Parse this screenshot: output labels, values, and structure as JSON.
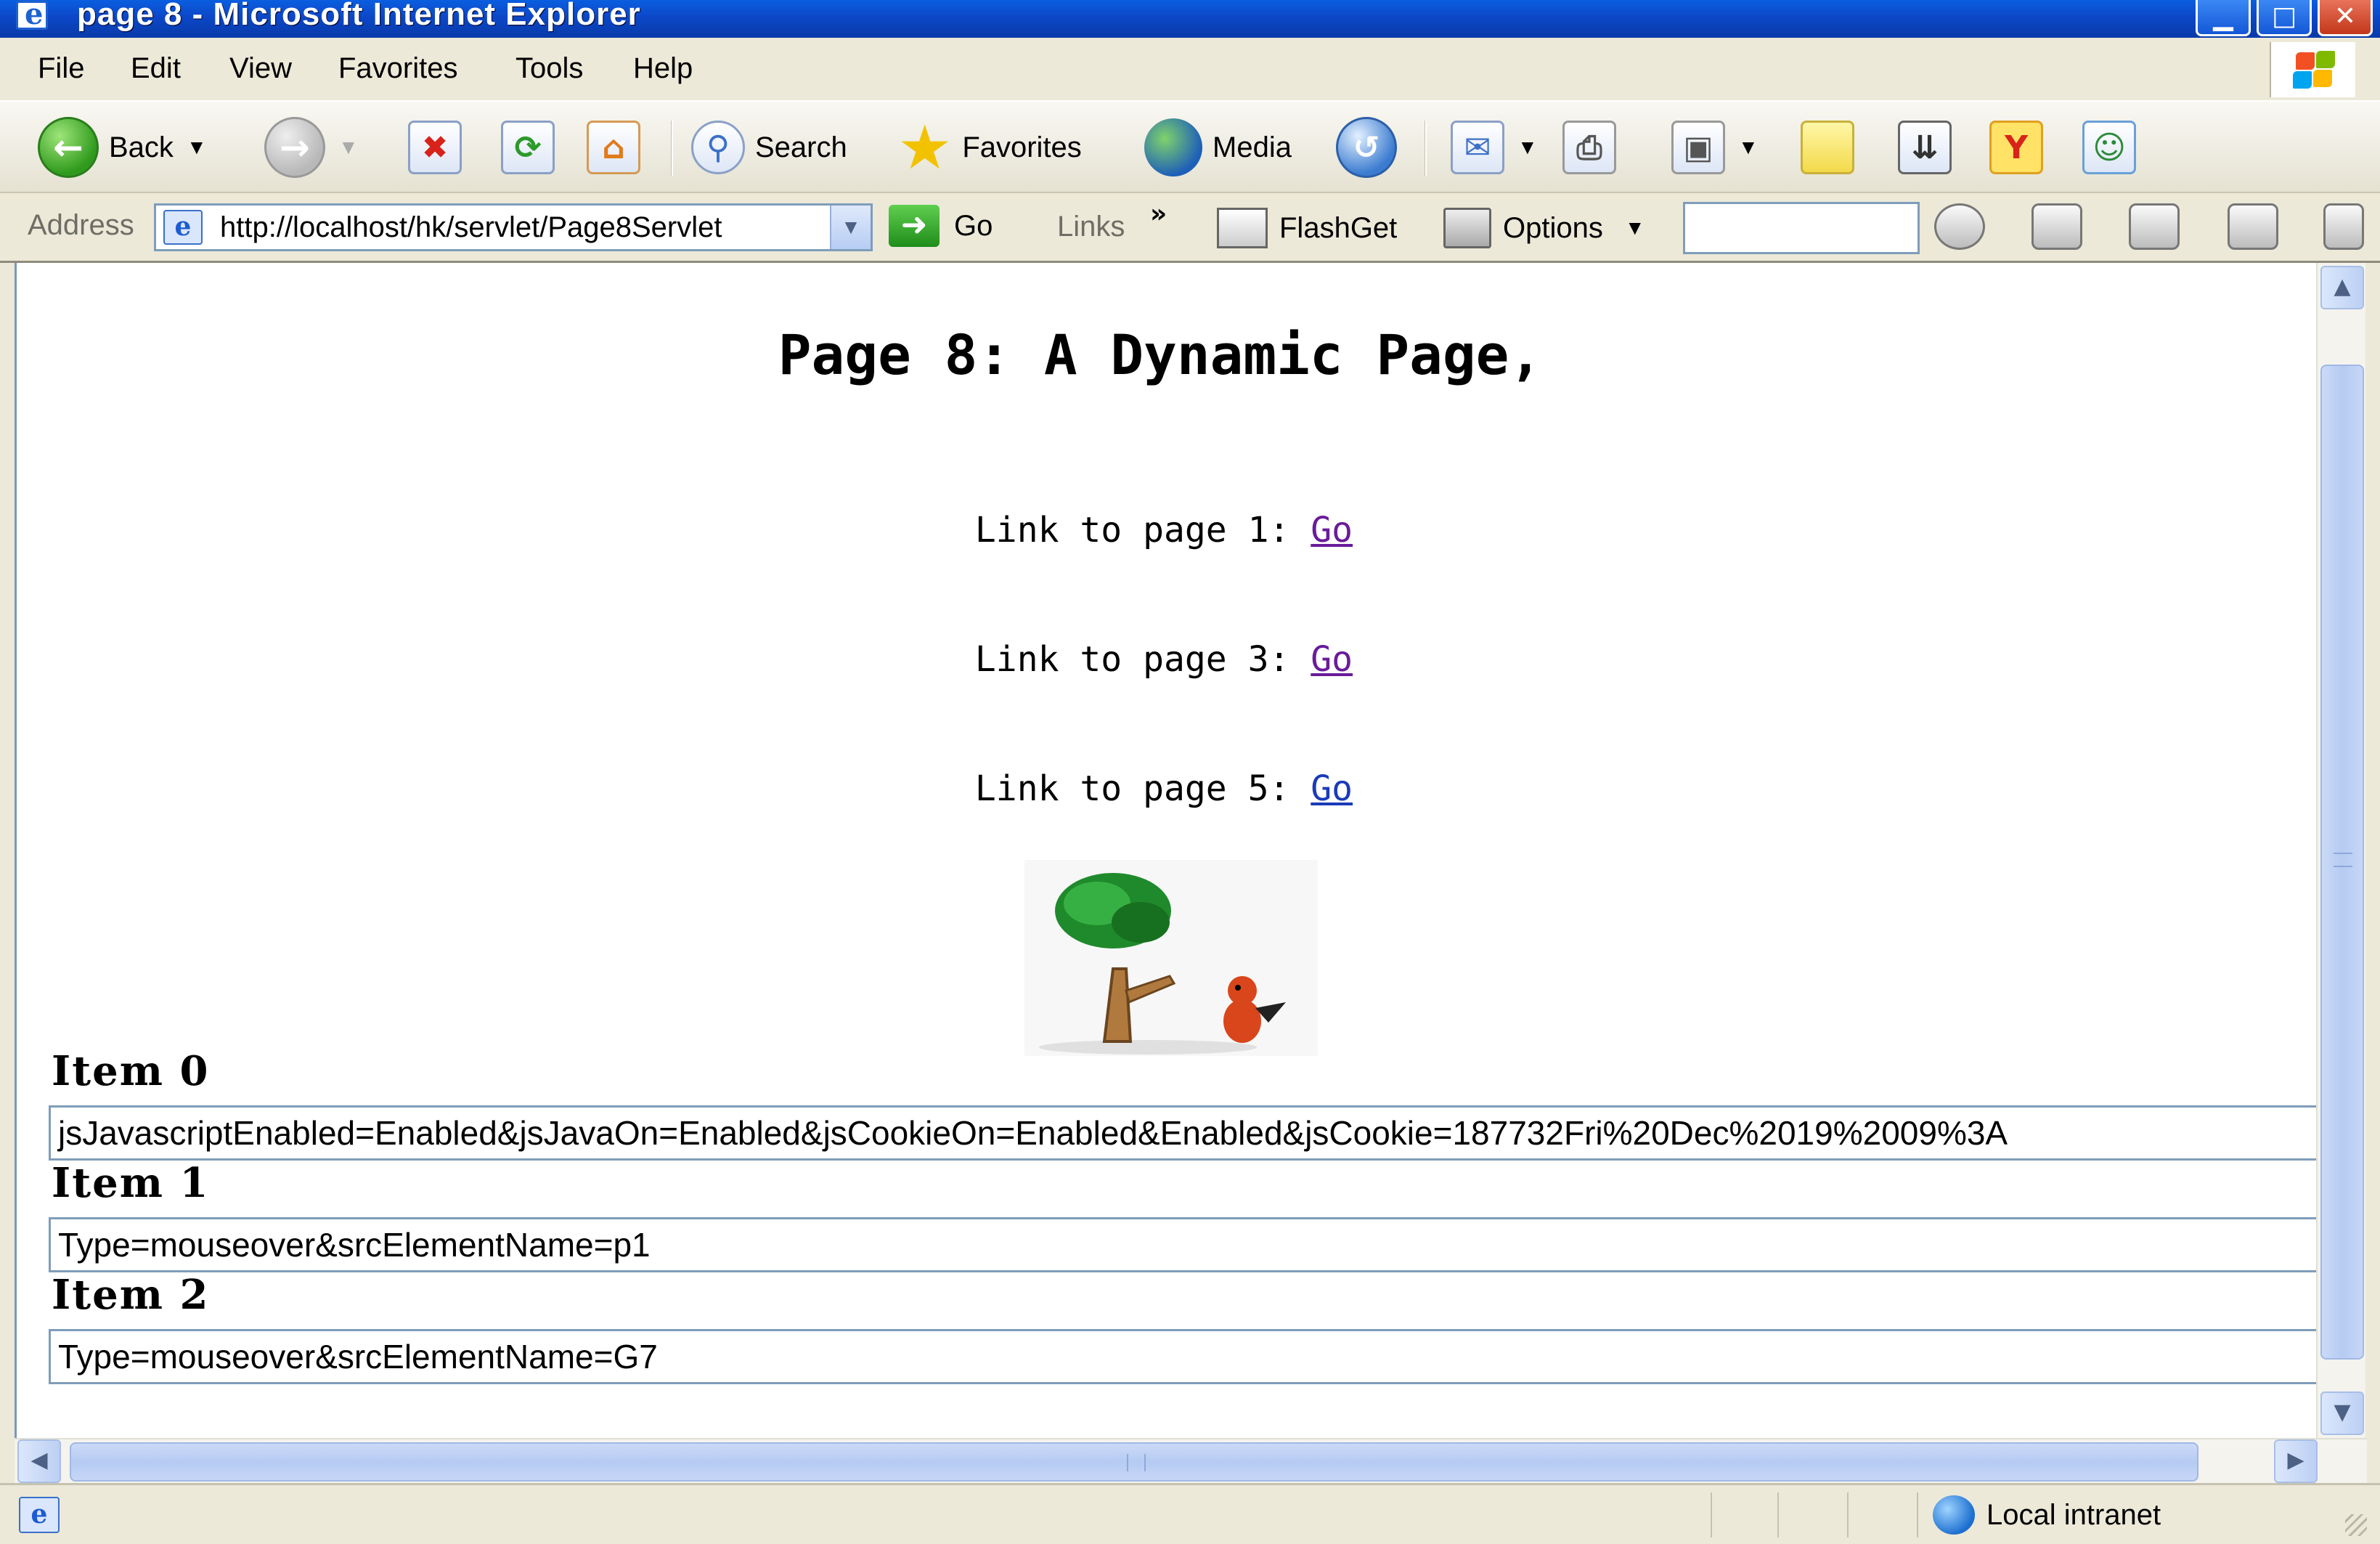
{
  "window": {
    "title": "page 8 - Microsoft Internet Explorer"
  },
  "menu": [
    "File",
    "Edit",
    "View",
    "Favorites",
    "Tools",
    "Help"
  ],
  "toolbar": {
    "back": "Back",
    "search": "Search",
    "favorites": "Favorites",
    "media": "Media"
  },
  "address": {
    "label": "Address",
    "url": "http://localhost/hk/servlet/Page8Servlet",
    "go": "Go",
    "links": "Links",
    "flashget": "FlashGet",
    "options": "Options"
  },
  "page": {
    "title": "Page 8: A Dynamic Page,",
    "links": [
      {
        "text": "Link to page 1: ",
        "go": "Go"
      },
      {
        "text": "Link to page 3: ",
        "go": "Go"
      },
      {
        "text": "Link to page 5: ",
        "go": "Go"
      }
    ],
    "items": [
      {
        "label": "Item 0",
        "value": "jsJavascriptEnabled=Enabled&jsJavaOn=Enabled&jsCookieOn=Enabled&Enabled&jsCookie=187732Fri%20Dec%2019%2009%3A"
      },
      {
        "label": "Item 1",
        "value": "Type=mouseover&srcElementName=p1"
      },
      {
        "label": "Item 2",
        "value": "Type=mouseover&srcElementName=G7"
      }
    ]
  },
  "status": {
    "zone": "Local intranet"
  },
  "colors": {
    "title_bar": "#0c47c8",
    "visited_link": "#6a1b9a",
    "link": "#1a3bb8"
  }
}
